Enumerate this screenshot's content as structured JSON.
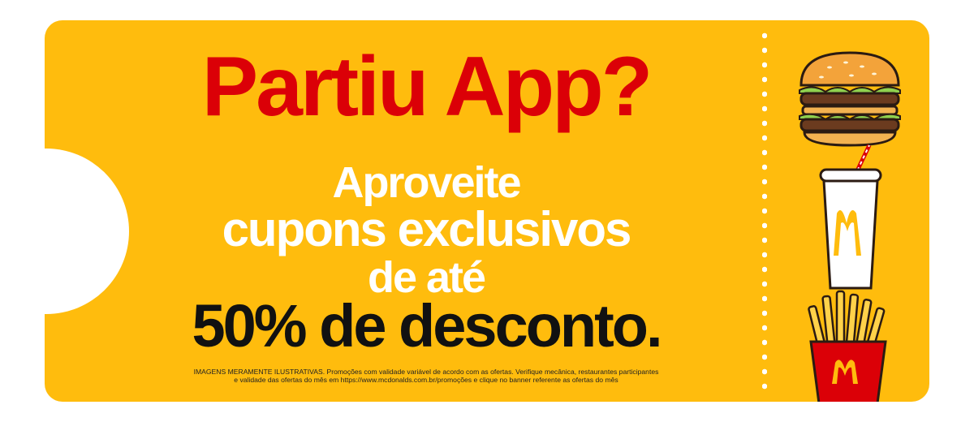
{
  "banner": {
    "headline": "Partiu App?",
    "line1": "Aproveite",
    "line2": "cupons exclusivos",
    "line3": "de até",
    "discount": "50% de desconto.",
    "disclaimer_line1": "IMAGENS MERAMENTE ILUSTRATIVAS. Promoções com validade variável de acordo com as ofertas. Verifique mecânica, restaurantes participantes",
    "disclaimer_line2": "e validade das ofertas do mês em https://www.mcdonalds.com.br/promoções e clique no banner referente as ofertas do mês"
  },
  "colors": {
    "ticket": "#ffbc0d",
    "headline": "#db0007",
    "subtext": "#ffffff",
    "discount": "#111111"
  },
  "icons": [
    "burger-icon",
    "drink-cup-icon",
    "fries-icon"
  ]
}
